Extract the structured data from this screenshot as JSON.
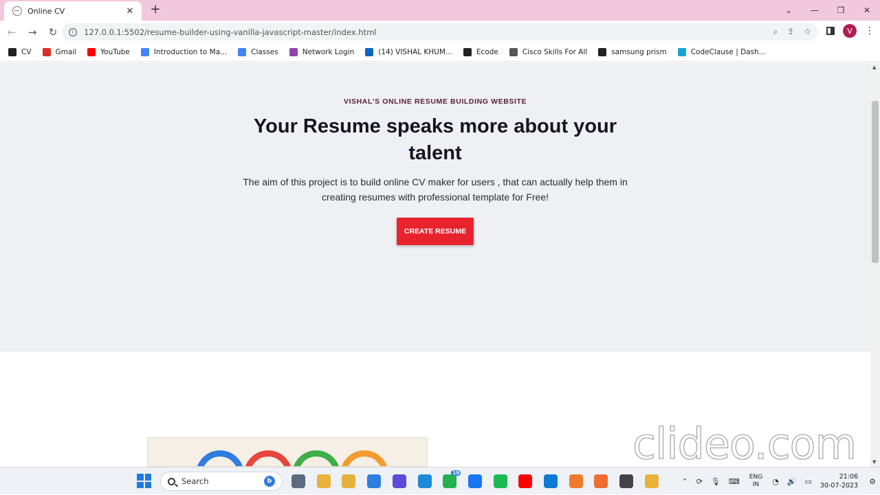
{
  "browser": {
    "tab_title": "Online CV",
    "tab_close": "✕",
    "new_tab": "+",
    "url": "127.0.0.1:5502/resume-builder-using-vanilla-javascript-master/index.html",
    "window_controls": [
      "⌄",
      "—",
      "❐",
      "✕"
    ],
    "profile_initial": "V",
    "bookmarks": [
      {
        "label": "CV",
        "icon": "globe-icon",
        "color": "#222222"
      },
      {
        "label": "Gmail",
        "icon": "gmail-icon",
        "color": "#d93025"
      },
      {
        "label": "YouTube",
        "icon": "youtube-icon",
        "color": "#ff0000"
      },
      {
        "label": "Introduction to Ma...",
        "icon": "google-icon",
        "color": "#4285f4"
      },
      {
        "label": "Classes",
        "icon": "google-icon",
        "color": "#4285f4"
      },
      {
        "label": "Network Login",
        "icon": "umbrella-icon",
        "color": "#8e44ad"
      },
      {
        "label": "(14) VISHAL KHUM...",
        "icon": "linkedin-icon",
        "color": "#0a66c2"
      },
      {
        "label": "Ecode",
        "icon": "github-icon",
        "color": "#222222"
      },
      {
        "label": "Cisco Skills For All",
        "icon": "cisco-icon",
        "color": "#555555"
      },
      {
        "label": "samsung prism",
        "icon": "github-icon",
        "color": "#222222"
      },
      {
        "label": "CodeClause | Dash...",
        "icon": "codeclause-icon",
        "color": "#1aa3d9"
      }
    ]
  },
  "hero": {
    "eyebrow": "VISHAL'S ONLINE RESUME BUILDING WEBSITE",
    "headline": "Your Resume speaks more about your talent",
    "lead": "The aim of this project is to build online CV maker for users , that can actually help them in creating resumes with professional template for Free!",
    "cta_label": "CREATE RESUME"
  },
  "colors": {
    "accent": "#e8232e",
    "tab_bar": "#f2c9dc",
    "hero_bg": "#eef0f4"
  },
  "watermark": "clideo.com",
  "taskbar": {
    "search_placeholder": "Search",
    "apps": [
      "file-explorer-icon",
      "chrome-icon",
      "folder-icon",
      "mail-icon",
      "video-editor-icon",
      "edge-icon",
      "whatsapp-icon",
      "facebook-icon",
      "spotify-icon",
      "youtube-icon",
      "vscode-icon",
      "xampp-icon",
      "postman-icon",
      "github-desktop-icon",
      "chrome-active-icon"
    ],
    "whatsapp_badge": "19",
    "lang_top": "ENG",
    "lang_bottom": "IN",
    "time": "21:06",
    "date": "30-07-2023"
  }
}
